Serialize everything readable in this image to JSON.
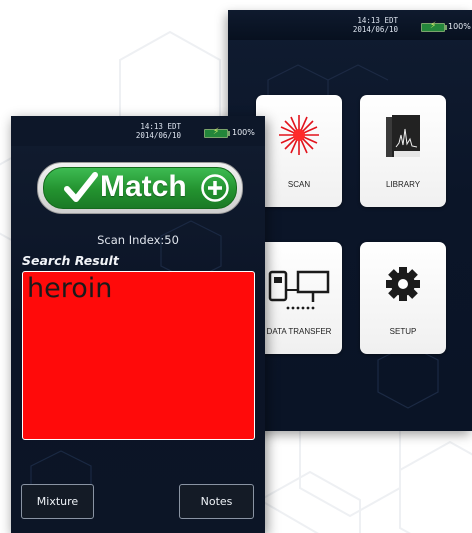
{
  "menu_screen": {
    "status": {
      "time": "14:13 EDT",
      "date": "2014/06/10",
      "battery": "100%"
    },
    "tiles": [
      {
        "label": "SCAN",
        "icon": "laser-starburst-icon"
      },
      {
        "label": "LIBRARY",
        "icon": "spectra-book-icon"
      },
      {
        "label": "DATA TRANSFER",
        "icon": "network-computers-icon"
      },
      {
        "label": "SETUP",
        "icon": "gear-icon"
      }
    ]
  },
  "result_screen": {
    "status": {
      "time": "14:13 EDT",
      "date": "2014/06/10",
      "battery": "100%"
    },
    "match_label": "Match",
    "scan_index": "Scan Index:50",
    "search_result_heading": "Search Result",
    "result_text": "heroin",
    "buttons": {
      "mixture": "Mixture",
      "notes": "Notes"
    }
  },
  "colors": {
    "match_green": "#23922f",
    "alert_red": "#ff0a0a",
    "screen_navy": "#0b1528",
    "laser_red": "#e2131c"
  }
}
